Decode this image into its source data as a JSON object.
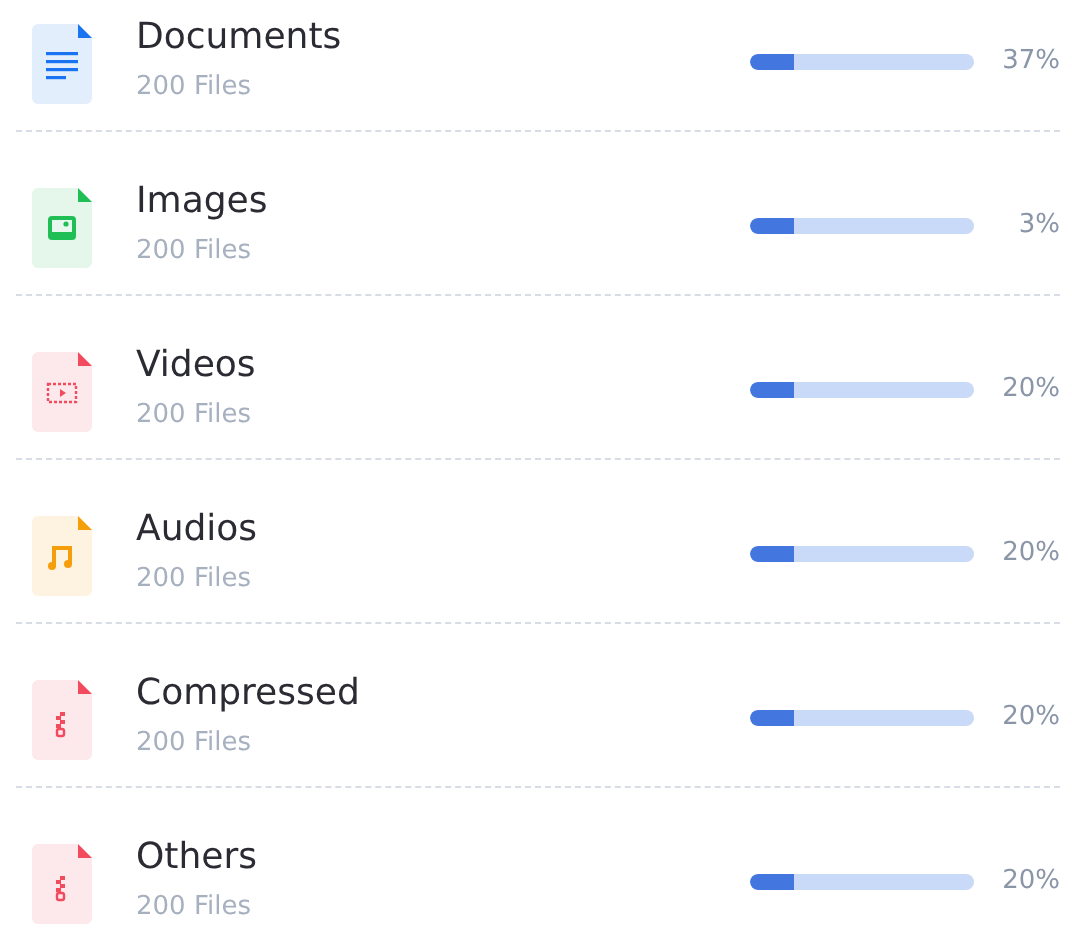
{
  "files": [
    {
      "kind": "documents",
      "name": "Documents",
      "count": "200 Files",
      "level": 0.2,
      "percent": "37%",
      "color": "#1a73f0"
    },
    {
      "kind": "images",
      "name": "Images",
      "count": "200 Files",
      "level": 0.2,
      "percent": "3%",
      "color": "#1fbf55"
    },
    {
      "kind": "videos",
      "name": "Videos",
      "count": "200 Files",
      "level": 0.2,
      "percent": "20%",
      "color": "#f24b5e"
    },
    {
      "kind": "audios",
      "name": "Audios",
      "count": "200 Files",
      "level": 0.2,
      "percent": "20%",
      "color": "#f59e0b"
    },
    {
      "kind": "compressed",
      "name": "Compressed",
      "count": "200 Files",
      "level": 0.2,
      "percent": "20%",
      "color": "#f24b5e"
    },
    {
      "kind": "others",
      "name": "Others",
      "count": "200 Files",
      "level": 0.2,
      "percent": "20%",
      "color": "#f24b5e"
    }
  ]
}
